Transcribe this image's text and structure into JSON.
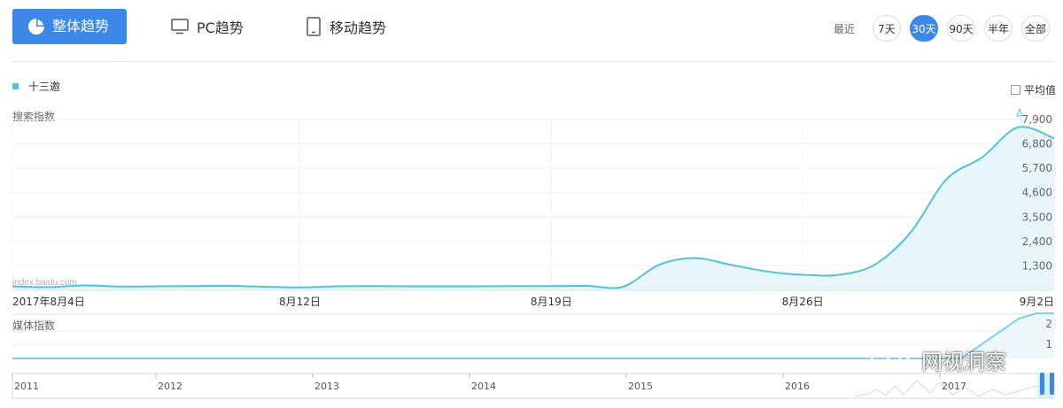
{
  "tabs": {
    "overall": {
      "label": "整体趋势",
      "icon": "pie-chart-icon"
    },
    "pc": {
      "label": "PC趋势",
      "icon": "monitor-icon"
    },
    "mobile": {
      "label": "移动趋势",
      "icon": "tablet-icon"
    }
  },
  "range": {
    "label": "最近",
    "options": [
      "7天",
      "30天",
      "90天",
      "半年",
      "全部"
    ],
    "selected": "30天"
  },
  "legend": {
    "series": "十三邀"
  },
  "average": {
    "label": "平均值",
    "checked": false
  },
  "search_chart": {
    "title": "搜索指数",
    "source": "index.baidu.com",
    "y_ticks": [
      "1,300",
      "2,400",
      "3,500",
      "4,600",
      "5,700",
      "6,800",
      "7,900"
    ],
    "x_ticks": [
      "2017年8月4日",
      "8月12日",
      "8月19日",
      "8月26日",
      "9月2日"
    ]
  },
  "media_chart": {
    "title": "媒体指数",
    "y_ticks": [
      "1",
      "2"
    ]
  },
  "timeline": {
    "years": [
      "2011",
      "2012",
      "2013",
      "2014",
      "2015",
      "2016",
      "2017"
    ]
  },
  "watermark": {
    "text": "网视洞察",
    "icon": "wechat-icon"
  },
  "colors": {
    "accent": "#3b88e8",
    "series": "#4fc3d9",
    "fill": "#e8f6fb"
  },
  "chart_data": {
    "type": "area",
    "title": "",
    "series": [
      {
        "name": "十三邀",
        "x": [
          "2017-08-04",
          "2017-08-05",
          "2017-08-06",
          "2017-08-07",
          "2017-08-08",
          "2017-08-09",
          "2017-08-10",
          "2017-08-11",
          "2017-08-12",
          "2017-08-13",
          "2017-08-14",
          "2017-08-15",
          "2017-08-16",
          "2017-08-17",
          "2017-08-18",
          "2017-08-19",
          "2017-08-20",
          "2017-08-21",
          "2017-08-22",
          "2017-08-23",
          "2017-08-24",
          "2017-08-25",
          "2017-08-26",
          "2017-08-27",
          "2017-08-28",
          "2017-08-29",
          "2017-08-30",
          "2017-08-31",
          "2017-09-01",
          "2017-09-02"
        ],
        "values": [
          380,
          340,
          420,
          370,
          380,
          390,
          400,
          360,
          330,
          380,
          390,
          380,
          380,
          380,
          390,
          390,
          400,
          360,
          1350,
          1650,
          1350,
          1050,
          900,
          900,
          1350,
          2800,
          5200,
          6200,
          7550,
          7050
        ]
      }
    ],
    "ylabel": "搜索指数",
    "ylim": [
      200,
      7900
    ],
    "grid": true,
    "legend": "top-left"
  }
}
